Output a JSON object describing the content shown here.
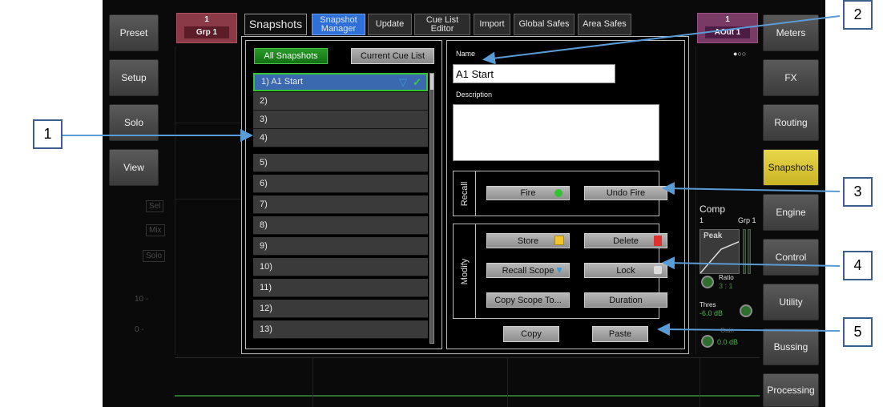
{
  "left_keys": [
    {
      "label": "Preset"
    },
    {
      "label": "Setup"
    },
    {
      "label": "Solo"
    },
    {
      "label": "View"
    }
  ],
  "left_strip_labels": [
    "Sel",
    "Mix",
    "Solo"
  ],
  "left_scale": [
    "10 -",
    "0 -"
  ],
  "right_keys": [
    {
      "label": "Meters"
    },
    {
      "label": "FX"
    },
    {
      "label": "Routing"
    },
    {
      "label": "Snapshots"
    },
    {
      "label": "Engine"
    },
    {
      "label": "Control"
    },
    {
      "label": "Utility"
    },
    {
      "label": "Bussing"
    },
    {
      "label": "Processing"
    }
  ],
  "left_channel": {
    "num": "1",
    "name": "Grp 1"
  },
  "right_channel": {
    "num": "1",
    "name": "AOut 1"
  },
  "title": "Snapshots",
  "tabs": [
    {
      "label": "Snapshot Manager"
    },
    {
      "label": "Update"
    },
    {
      "label": "Cue List Editor"
    },
    {
      "label": "Import"
    },
    {
      "label": "Global Safes"
    },
    {
      "label": "Area Safes"
    }
  ],
  "list_buttons": {
    "all": "All Snapshots",
    "cue": "Current Cue List"
  },
  "snapshots": [
    "1) A1 Start",
    "2)",
    "3)",
    "4)",
    "5)",
    "6)",
    "7)",
    "8)",
    "9)",
    "10)",
    "11)",
    "12)",
    "13)"
  ],
  "name_label": "Name",
  "name_value": "A1 Start",
  "description_label": "Description",
  "description_value": "",
  "recall": {
    "section": "Recall",
    "fire": "Fire",
    "undo": "Undo Fire"
  },
  "modify": {
    "section": "Modify",
    "store": "Store",
    "delete": "Delete",
    "recall_scope": "Recall Scope",
    "lock": "Lock",
    "copy_scope": "Copy Scope To...",
    "duration": "Duration"
  },
  "copy": "Copy",
  "paste": "Paste",
  "comp": {
    "title": "Comp",
    "left": "1",
    "right": "Grp 1",
    "peak": "Peak",
    "ratio_label": "Ratio",
    "ratio_value": "3 : 1",
    "thres_label": "Thres",
    "thres_value": "-6.0 dB",
    "gain_label": "Gain",
    "gain_value": "0.0 dB"
  },
  "callouts": [
    "1",
    "2",
    "3",
    "4",
    "5"
  ],
  "colors": {
    "accent_blue": "#2f6fd8",
    "select_green": "#34c434",
    "snapshot_yellow": "#d8c634",
    "callout_line": "#5b9bd5"
  }
}
